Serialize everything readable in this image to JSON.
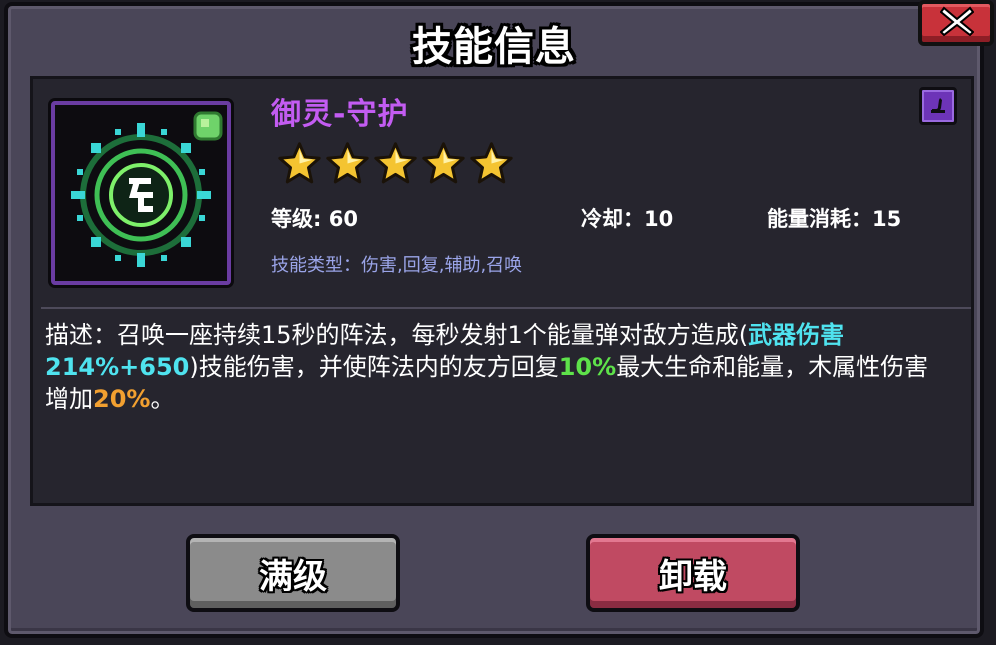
{
  "dialog": {
    "title": "技能信息",
    "close_icon": "close-x-icon"
  },
  "skill": {
    "name": "御灵-守护",
    "icon": "summon-formation-icon",
    "type_badge_icon": "staff-type-icon",
    "stars": 5,
    "level_text": "等级: 60",
    "cooldown_text": "冷却：10",
    "energy_text": "能量消耗：15",
    "type_text": "技能类型：伤害,回复,辅助,召唤"
  },
  "description": {
    "part1": "描述：召唤一座持续15秒的阵法，每秒发射1个能量弹对敌方造成(",
    "hl_weapon": "武器伤害214%+650",
    "part2": ")技能伤害，并使阵法内的友方回复",
    "hl_heal": "10%",
    "part3": "最大生命和能量，木属性伤害增加",
    "hl_bonus": "20%",
    "part4": "。"
  },
  "buttons": {
    "max_label": "满级",
    "unload_label": "卸载"
  },
  "colors": {
    "name": "#c35cf2",
    "highlight_cyan": "#4fe3ef",
    "highlight_green": "#5ee24a",
    "highlight_orange": "#f2a030",
    "star": "#f4c431"
  }
}
